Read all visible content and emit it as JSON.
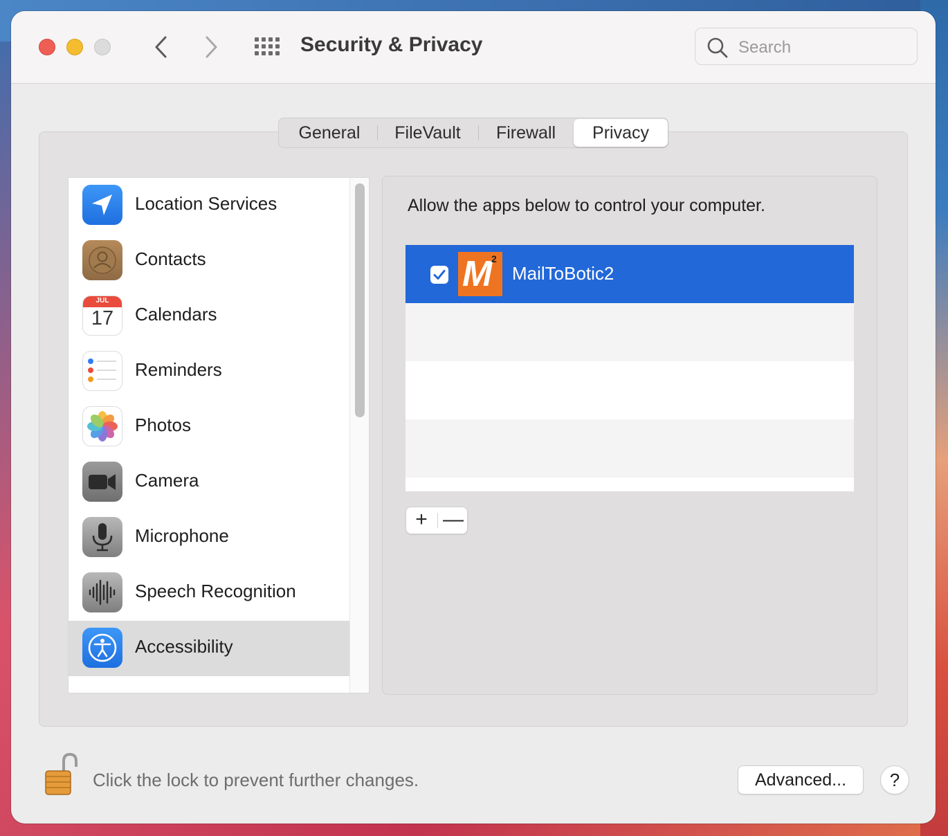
{
  "window": {
    "title": "Security & Privacy",
    "search_placeholder": "Search"
  },
  "tabs": [
    {
      "label": "General",
      "selected": false
    },
    {
      "label": "FileVault",
      "selected": false
    },
    {
      "label": "Firewall",
      "selected": false
    },
    {
      "label": "Privacy",
      "selected": true
    }
  ],
  "sidebar": {
    "items": [
      {
        "label": "Location Services",
        "icon": "location-arrow-icon",
        "selected": false
      },
      {
        "label": "Contacts",
        "icon": "contacts-icon",
        "selected": false
      },
      {
        "label": "Calendars",
        "icon": "calendar-icon",
        "selected": false,
        "icon_month": "JUL",
        "icon_day": "17"
      },
      {
        "label": "Reminders",
        "icon": "reminders-icon",
        "selected": false
      },
      {
        "label": "Photos",
        "icon": "photos-icon",
        "selected": false
      },
      {
        "label": "Camera",
        "icon": "camera-icon",
        "selected": false
      },
      {
        "label": "Microphone",
        "icon": "microphone-icon",
        "selected": false
      },
      {
        "label": "Speech Recognition",
        "icon": "waveform-icon",
        "selected": false
      },
      {
        "label": "Accessibility",
        "icon": "accessibility-icon",
        "selected": true
      }
    ]
  },
  "main": {
    "description": "Allow the apps below to control your computer.",
    "apps": [
      {
        "name": "MailToBotic2",
        "checked": true,
        "selected": true,
        "icon": "mailtobotic-app-icon",
        "icon_letter": "M",
        "icon_super": "2"
      }
    ],
    "add_label": "+",
    "remove_label": "—"
  },
  "footer": {
    "lock_text": "Click the lock to prevent further changes.",
    "advanced_label": "Advanced...",
    "help_label": "?"
  },
  "colors": {
    "selection_blue": "#2268d8",
    "app_icon_orange": "#ef7421",
    "close_red": "#ee5e55",
    "minimize_yellow": "#f4bc2f"
  }
}
